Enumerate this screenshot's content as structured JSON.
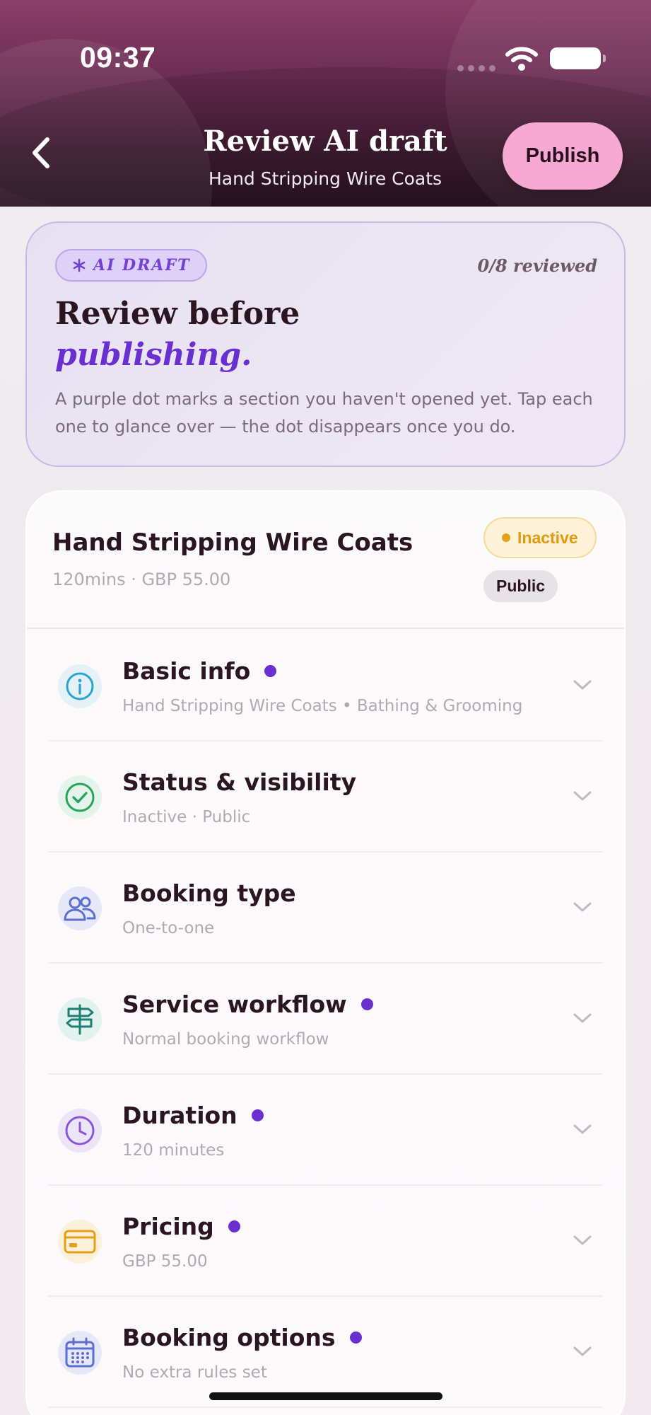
{
  "status_bar": {
    "time": "09:37"
  },
  "header": {
    "title": "Review AI draft",
    "subtitle": "Hand Stripping Wire Coats",
    "publish_label": "Publish"
  },
  "draft_card": {
    "badge_label": "AI DRAFT",
    "badge_icon": "asterisk-icon",
    "reviewed": "0/8 reviewed",
    "heading": "Review before",
    "heading_em": "publishing.",
    "body": "A purple dot marks a section you haven't opened yet. Tap each one to glance over — the dot disappears once you do."
  },
  "service": {
    "title": "Hand Stripping Wire Coats",
    "meta": "120mins · GBP 55.00",
    "status_badge": "Inactive",
    "visibility_badge": "Public"
  },
  "colors": {
    "accent_purple": "#6a2fd0",
    "publish_pink": "#f6a9d3",
    "inactive_amber": "#e09a12"
  },
  "sections": [
    {
      "title": "Basic info",
      "subtitle": "Hand Stripping Wire Coats • Bathing & Grooming",
      "icon": "info-icon",
      "unread": true
    },
    {
      "title": "Status & visibility",
      "subtitle": "Inactive · Public",
      "icon": "check-circle-icon",
      "unread": false
    },
    {
      "title": "Booking type",
      "subtitle": "One-to-one",
      "icon": "users-icon",
      "unread": false
    },
    {
      "title": "Service workflow",
      "subtitle": "Normal booking workflow",
      "icon": "signpost-icon",
      "unread": true
    },
    {
      "title": "Duration",
      "subtitle": "120 minutes",
      "icon": "clock-icon",
      "unread": true
    },
    {
      "title": "Pricing",
      "subtitle": "GBP 55.00",
      "icon": "credit-card-icon",
      "unread": true
    },
    {
      "title": "Booking options",
      "subtitle": "No extra rules set",
      "icon": "calendar-icon",
      "unread": true
    }
  ]
}
